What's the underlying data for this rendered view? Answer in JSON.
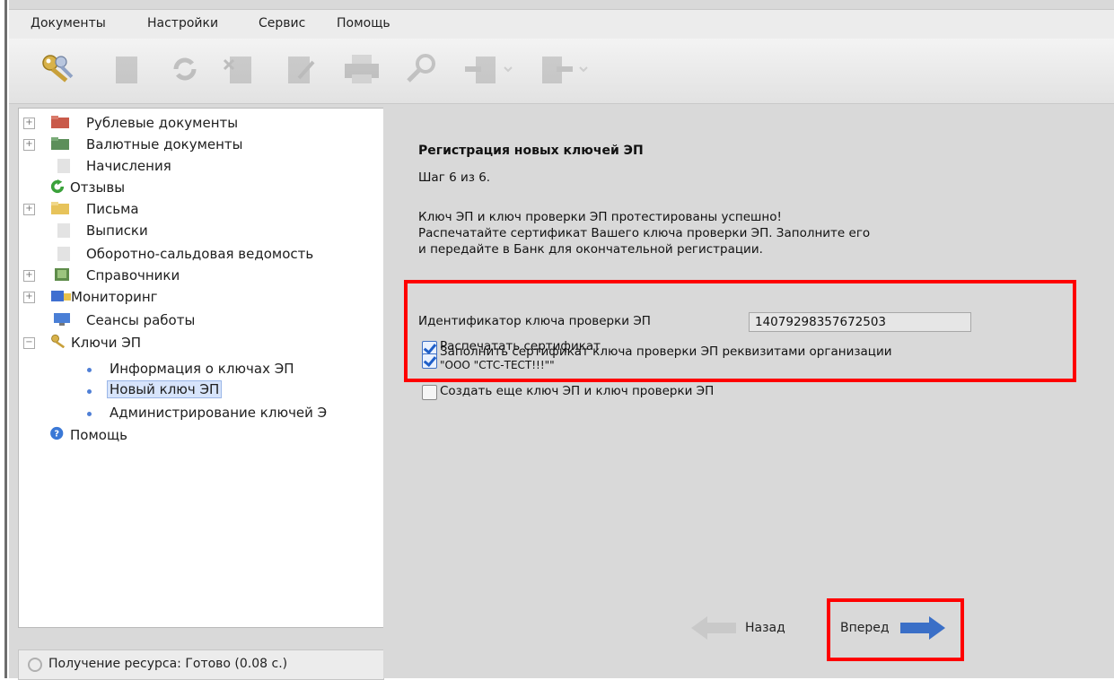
{
  "menu": [
    "Документы",
    "Настройки",
    "Сервис",
    "Помощь"
  ],
  "tree": {
    "items": [
      {
        "label": "Рублевые документы"
      },
      {
        "label": "Валютные документы"
      },
      {
        "label": "Начисления"
      },
      {
        "label": "Отзывы"
      },
      {
        "label": "Письма"
      },
      {
        "label": "Выписки"
      },
      {
        "label": "Оборотно-сальдовая ведомость"
      },
      {
        "label": "Справочники"
      },
      {
        "label": "Мониторинг"
      },
      {
        "label": "Сеансы работы"
      },
      {
        "label": "Ключи ЭП"
      },
      {
        "label": "Информация о ключах ЭП"
      },
      {
        "label": "Новый ключ ЭП"
      },
      {
        "label": "Администрирование ключей Э"
      },
      {
        "label": "Помощь"
      }
    ]
  },
  "status": "Получение ресурса: Готово (0.08 с.)",
  "wizard": {
    "title": "Регистрация новых ключей ЭП",
    "step": "Шаг 6 из 6.",
    "message": [
      "Ключ ЭП и ключ проверки ЭП протестированы успешно!",
      "Распечатайте сертификат Вашего ключа проверки ЭП. Заполните его",
      "и передайте в Банк для окончательной регистрации."
    ],
    "key_id_label": "Идентификатор ключа проверки ЭП",
    "key_id_value": "14079298357672503",
    "print_cert_label": "Распечатать сертификат",
    "fill_cert_label_1": "Заполнить сертификат ключа проверки ЭП реквизитами организации",
    "fill_cert_label_2": "\"ООО \"СТС-ТЕСТ!!!\"\"",
    "create_more_label": "Создать еще ключ ЭП и ключ проверки ЭП",
    "checkboxes": {
      "print_cert": true,
      "fill_cert": true,
      "create_more": false
    },
    "back_label": "Назад",
    "next_label": "Вперед"
  },
  "colors": {
    "highlight": "#ff0000",
    "arrow": "#3a6fc7"
  }
}
